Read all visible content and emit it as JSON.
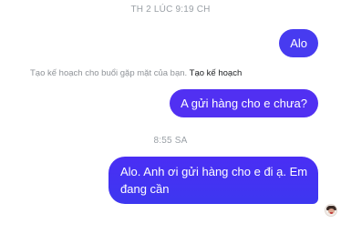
{
  "timestamps": {
    "top": "TH 2 LÚC 9:19 CH",
    "middle": "8:55 SA"
  },
  "messages": [
    {
      "text": "Alo"
    },
    {
      "text": "A gửi hàng cho e chưa?"
    },
    {
      "text": "Alo. Anh ơi gửi hàng cho e đi ạ. Em đang cần"
    }
  ],
  "plan_hint": {
    "text": "Tạo kế hoạch cho buổi gặp mặt của bạn.",
    "link": "Tạo kế hoạch"
  },
  "colors": {
    "bubble": "#473bf0",
    "timestamp": "#9aa0a6"
  },
  "icons": {
    "seen_avatar": "avatar"
  }
}
